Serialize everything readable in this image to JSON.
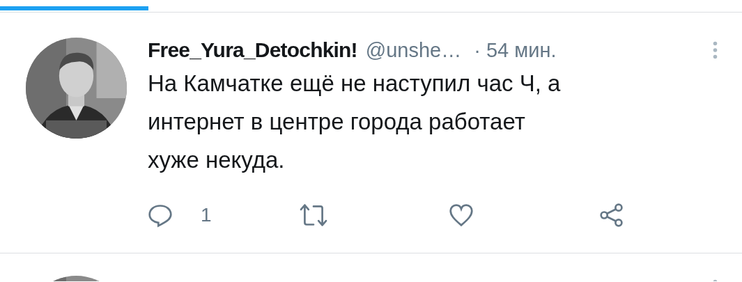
{
  "tab_indicator": {
    "level": 0.2
  },
  "tweets": [
    {
      "avatar": {
        "kind": "picture"
      },
      "name": "Free_Yura_Detochkin!",
      "handle": "@unshe…",
      "time": "· 54 мин.",
      "text": "На Камчатке ещё не наступил час Ч, а интернет в центре города работает хуже некуда.",
      "replies": "1"
    },
    {
      "avatar": {
        "kind": "picture"
      }
    }
  ]
}
